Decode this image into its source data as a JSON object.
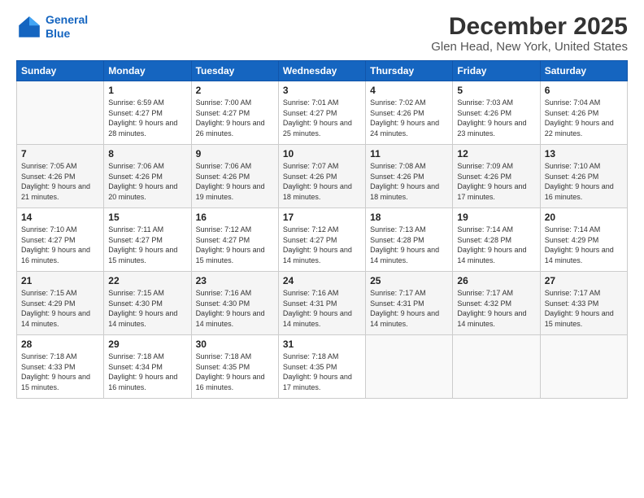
{
  "logo": {
    "line1": "General",
    "line2": "Blue"
  },
  "title": "December 2025",
  "subtitle": "Glen Head, New York, United States",
  "header": {
    "days": [
      "Sunday",
      "Monday",
      "Tuesday",
      "Wednesday",
      "Thursday",
      "Friday",
      "Saturday"
    ]
  },
  "weeks": [
    [
      {
        "day": "",
        "sunrise": "",
        "sunset": "",
        "daylight": ""
      },
      {
        "day": "1",
        "sunrise": "Sunrise: 6:59 AM",
        "sunset": "Sunset: 4:27 PM",
        "daylight": "Daylight: 9 hours and 28 minutes."
      },
      {
        "day": "2",
        "sunrise": "Sunrise: 7:00 AM",
        "sunset": "Sunset: 4:27 PM",
        "daylight": "Daylight: 9 hours and 26 minutes."
      },
      {
        "day": "3",
        "sunrise": "Sunrise: 7:01 AM",
        "sunset": "Sunset: 4:27 PM",
        "daylight": "Daylight: 9 hours and 25 minutes."
      },
      {
        "day": "4",
        "sunrise": "Sunrise: 7:02 AM",
        "sunset": "Sunset: 4:26 PM",
        "daylight": "Daylight: 9 hours and 24 minutes."
      },
      {
        "day": "5",
        "sunrise": "Sunrise: 7:03 AM",
        "sunset": "Sunset: 4:26 PM",
        "daylight": "Daylight: 9 hours and 23 minutes."
      },
      {
        "day": "6",
        "sunrise": "Sunrise: 7:04 AM",
        "sunset": "Sunset: 4:26 PM",
        "daylight": "Daylight: 9 hours and 22 minutes."
      }
    ],
    [
      {
        "day": "7",
        "sunrise": "Sunrise: 7:05 AM",
        "sunset": "Sunset: 4:26 PM",
        "daylight": "Daylight: 9 hours and 21 minutes."
      },
      {
        "day": "8",
        "sunrise": "Sunrise: 7:06 AM",
        "sunset": "Sunset: 4:26 PM",
        "daylight": "Daylight: 9 hours and 20 minutes."
      },
      {
        "day": "9",
        "sunrise": "Sunrise: 7:06 AM",
        "sunset": "Sunset: 4:26 PM",
        "daylight": "Daylight: 9 hours and 19 minutes."
      },
      {
        "day": "10",
        "sunrise": "Sunrise: 7:07 AM",
        "sunset": "Sunset: 4:26 PM",
        "daylight": "Daylight: 9 hours and 18 minutes."
      },
      {
        "day": "11",
        "sunrise": "Sunrise: 7:08 AM",
        "sunset": "Sunset: 4:26 PM",
        "daylight": "Daylight: 9 hours and 18 minutes."
      },
      {
        "day": "12",
        "sunrise": "Sunrise: 7:09 AM",
        "sunset": "Sunset: 4:26 PM",
        "daylight": "Daylight: 9 hours and 17 minutes."
      },
      {
        "day": "13",
        "sunrise": "Sunrise: 7:10 AM",
        "sunset": "Sunset: 4:26 PM",
        "daylight": "Daylight: 9 hours and 16 minutes."
      }
    ],
    [
      {
        "day": "14",
        "sunrise": "Sunrise: 7:10 AM",
        "sunset": "Sunset: 4:27 PM",
        "daylight": "Daylight: 9 hours and 16 minutes."
      },
      {
        "day": "15",
        "sunrise": "Sunrise: 7:11 AM",
        "sunset": "Sunset: 4:27 PM",
        "daylight": "Daylight: 9 hours and 15 minutes."
      },
      {
        "day": "16",
        "sunrise": "Sunrise: 7:12 AM",
        "sunset": "Sunset: 4:27 PM",
        "daylight": "Daylight: 9 hours and 15 minutes."
      },
      {
        "day": "17",
        "sunrise": "Sunrise: 7:12 AM",
        "sunset": "Sunset: 4:27 PM",
        "daylight": "Daylight: 9 hours and 14 minutes."
      },
      {
        "day": "18",
        "sunrise": "Sunrise: 7:13 AM",
        "sunset": "Sunset: 4:28 PM",
        "daylight": "Daylight: 9 hours and 14 minutes."
      },
      {
        "day": "19",
        "sunrise": "Sunrise: 7:14 AM",
        "sunset": "Sunset: 4:28 PM",
        "daylight": "Daylight: 9 hours and 14 minutes."
      },
      {
        "day": "20",
        "sunrise": "Sunrise: 7:14 AM",
        "sunset": "Sunset: 4:29 PM",
        "daylight": "Daylight: 9 hours and 14 minutes."
      }
    ],
    [
      {
        "day": "21",
        "sunrise": "Sunrise: 7:15 AM",
        "sunset": "Sunset: 4:29 PM",
        "daylight": "Daylight: 9 hours and 14 minutes."
      },
      {
        "day": "22",
        "sunrise": "Sunrise: 7:15 AM",
        "sunset": "Sunset: 4:30 PM",
        "daylight": "Daylight: 9 hours and 14 minutes."
      },
      {
        "day": "23",
        "sunrise": "Sunrise: 7:16 AM",
        "sunset": "Sunset: 4:30 PM",
        "daylight": "Daylight: 9 hours and 14 minutes."
      },
      {
        "day": "24",
        "sunrise": "Sunrise: 7:16 AM",
        "sunset": "Sunset: 4:31 PM",
        "daylight": "Daylight: 9 hours and 14 minutes."
      },
      {
        "day": "25",
        "sunrise": "Sunrise: 7:17 AM",
        "sunset": "Sunset: 4:31 PM",
        "daylight": "Daylight: 9 hours and 14 minutes."
      },
      {
        "day": "26",
        "sunrise": "Sunrise: 7:17 AM",
        "sunset": "Sunset: 4:32 PM",
        "daylight": "Daylight: 9 hours and 14 minutes."
      },
      {
        "day": "27",
        "sunrise": "Sunrise: 7:17 AM",
        "sunset": "Sunset: 4:33 PM",
        "daylight": "Daylight: 9 hours and 15 minutes."
      }
    ],
    [
      {
        "day": "28",
        "sunrise": "Sunrise: 7:18 AM",
        "sunset": "Sunset: 4:33 PM",
        "daylight": "Daylight: 9 hours and 15 minutes."
      },
      {
        "day": "29",
        "sunrise": "Sunrise: 7:18 AM",
        "sunset": "Sunset: 4:34 PM",
        "daylight": "Daylight: 9 hours and 16 minutes."
      },
      {
        "day": "30",
        "sunrise": "Sunrise: 7:18 AM",
        "sunset": "Sunset: 4:35 PM",
        "daylight": "Daylight: 9 hours and 16 minutes."
      },
      {
        "day": "31",
        "sunrise": "Sunrise: 7:18 AM",
        "sunset": "Sunset: 4:35 PM",
        "daylight": "Daylight: 9 hours and 17 minutes."
      },
      {
        "day": "",
        "sunrise": "",
        "sunset": "",
        "daylight": ""
      },
      {
        "day": "",
        "sunrise": "",
        "sunset": "",
        "daylight": ""
      },
      {
        "day": "",
        "sunrise": "",
        "sunset": "",
        "daylight": ""
      }
    ]
  ]
}
